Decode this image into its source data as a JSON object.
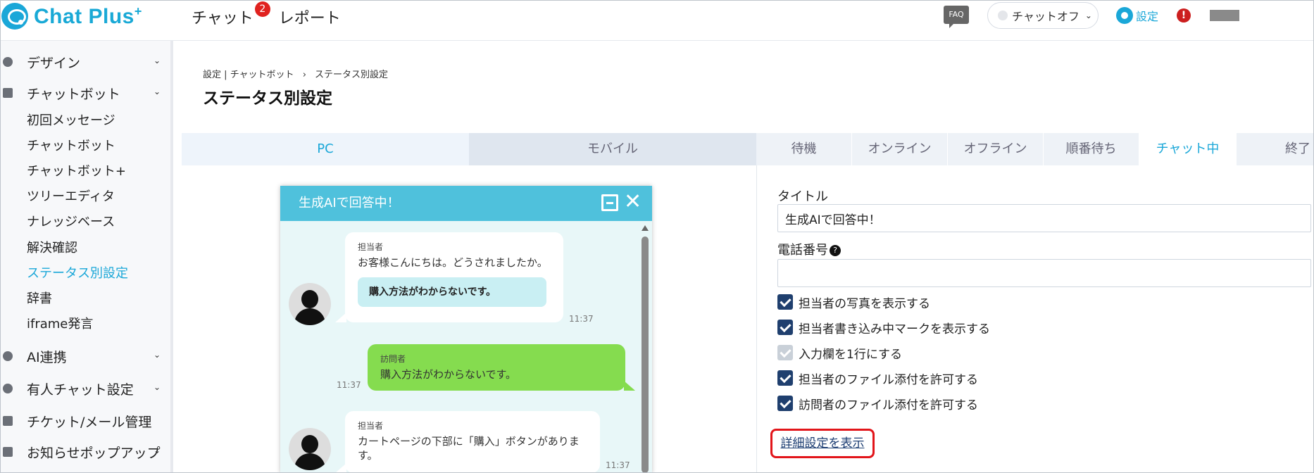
{
  "app": {
    "name": "Chat Plus",
    "name_suffix": "+"
  },
  "topnav": {
    "items": [
      {
        "label": "チャット",
        "badge": "2"
      },
      {
        "label": "レポート"
      }
    ],
    "faq_label": "FAQ",
    "chat_status": "チャットオフ",
    "settings_label": "設定",
    "alert_label": "!"
  },
  "sidebar": {
    "sections": [
      {
        "label": "デザイン"
      },
      {
        "label": "チャットボット"
      },
      {
        "label": "AI連携"
      },
      {
        "label": "有人チャット設定"
      },
      {
        "label": "チケット/メール管理"
      },
      {
        "label": "お知らせポップアップ"
      }
    ],
    "chatbot_items": [
      "初回メッセージ",
      "チャットボット",
      "チャットボット+",
      "ツリーエディタ",
      "ナレッジベース",
      "解決確認",
      "ステータス別設定",
      "辞書",
      "iframe発言"
    ],
    "active_item": "ステータス別設定"
  },
  "breadcrumb": {
    "part1": "設定",
    "sep1": "|",
    "part2": "チャットボット",
    "sep2": "›",
    "part3": "ステータス別設定"
  },
  "page_title": "ステータス別設定",
  "device_tabs": [
    "PC",
    "モバイル"
  ],
  "status_tabs": [
    "待機",
    "オンライン",
    "オフライン",
    "順番待ち",
    "チャット中",
    "終了"
  ],
  "active_status_tab": "チャット中",
  "preview": {
    "header_title": "生成AIで回答中！",
    "messages": [
      {
        "who": "担当者",
        "text": "お客様こんにちは。どうされましたか。",
        "chip": "購入方法がわからないです。",
        "time": "11:37"
      },
      {
        "who": "訪問者",
        "text": "購入方法がわからないです。",
        "time": "11:37"
      },
      {
        "who": "担当者",
        "text": "カートページの下部に「購入」ボタンがあります。",
        "time": "11:37"
      }
    ]
  },
  "form": {
    "title_label": "タイトル",
    "title_value": "生成AIで回答中！",
    "phone_label": "電話番号",
    "phone_value": "",
    "checkboxes": [
      {
        "label": "担当者の写真を表示する",
        "checked": true
      },
      {
        "label": "担当者書き込み中マークを表示する",
        "checked": true
      },
      {
        "label": "入力欄を1行にする",
        "checked": true,
        "disabled": true
      },
      {
        "label": "担当者のファイル添付を許可する",
        "checked": true
      },
      {
        "label": "訪問者のファイル添付を許可する",
        "checked": true
      }
    ],
    "detail_link": "詳細設定を表示"
  },
  "colors": {
    "brand": "#1aa7d8",
    "chat_header": "#4fc1dc",
    "visitor_bubble": "#85dc4f",
    "highlight": "#e2151a"
  }
}
